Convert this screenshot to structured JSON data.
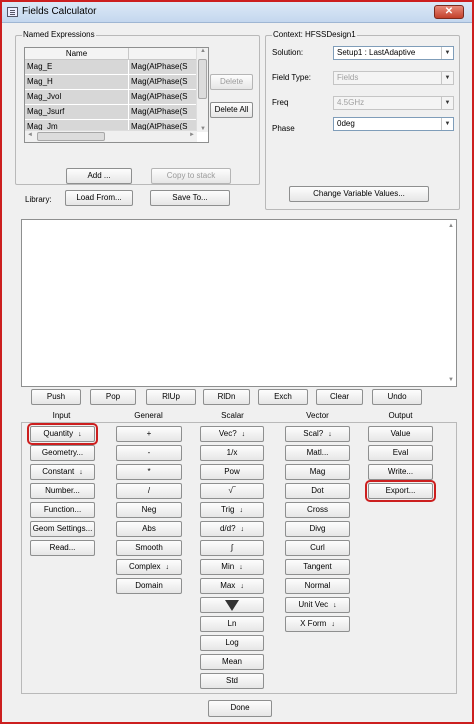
{
  "window": {
    "title": "Fields Calculator",
    "close_glyph": "✕"
  },
  "named_expressions": {
    "group_label": "Named Expressions",
    "columns": [
      "Name",
      ""
    ],
    "rows": [
      [
        "Mag_E",
        "Mag(AtPhase(S"
      ],
      [
        "Mag_H",
        "Mag(AtPhase(S"
      ],
      [
        "Mag_Jvol",
        "Mag(AtPhase(S"
      ],
      [
        "Mag_Jsurf",
        "Mag(AtPhase(S"
      ],
      [
        "Mag_Jm",
        "Mag(AtPhase(S"
      ]
    ],
    "delete_label": "Delete",
    "delete_all_label": "Delete All",
    "add_label": "Add ...",
    "copy_to_stack_label": "Copy to stack",
    "library_label": "Library:",
    "load_from_label": "Load From...",
    "save_to_label": "Save To..."
  },
  "context": {
    "group_label": "Context: HFSSDesign1",
    "solution_label": "Solution:",
    "solution_value": "Setup1 : LastAdaptive",
    "field_type_label": "Field Type:",
    "field_type_value": "Fields",
    "freq_label": "Freq",
    "freq_value": "4.5GHz",
    "phase_label": "Phase",
    "phase_value": "0deg",
    "change_vars_label": "Change Variable Values..."
  },
  "stack_buttons": [
    "Push",
    "Pop",
    "RlUp",
    "RlDn",
    "Exch",
    "Clear",
    "Undo"
  ],
  "categories": [
    "Input",
    "General",
    "Scalar",
    "Vector",
    "Output"
  ],
  "input": [
    "Quantity",
    "Geometry...",
    "Constant",
    "Number...",
    "Function...",
    "Geom Settings...",
    "Read..."
  ],
  "general": [
    "+",
    "-",
    "*",
    "/",
    "Neg",
    "Abs",
    "Smooth",
    "Complex",
    "Domain"
  ],
  "scalar": [
    "Vec?",
    "1/x",
    "Pow",
    "",
    "Trig",
    "d/d?",
    "",
    "Min",
    "Max",
    "",
    "Ln",
    "Log",
    "Mean",
    "Std"
  ],
  "vector": [
    "Scal?",
    "Matl...",
    "Mag",
    "Dot",
    "Cross",
    "Divg",
    "Curl",
    "Tangent",
    "Normal",
    "Unit Vec",
    "X Form"
  ],
  "output": [
    "Value",
    "Eval",
    "Write...",
    "Export..."
  ],
  "symbols": {
    "sqrt": "√‾",
    "integral": "∫",
    "dropdown": "▼",
    "scroll_left": "◄",
    "scroll_right": "►",
    "scroll_up": "▲",
    "scroll_down": "▼",
    "dropdown_flag": "↓"
  },
  "done_label": "Done"
}
